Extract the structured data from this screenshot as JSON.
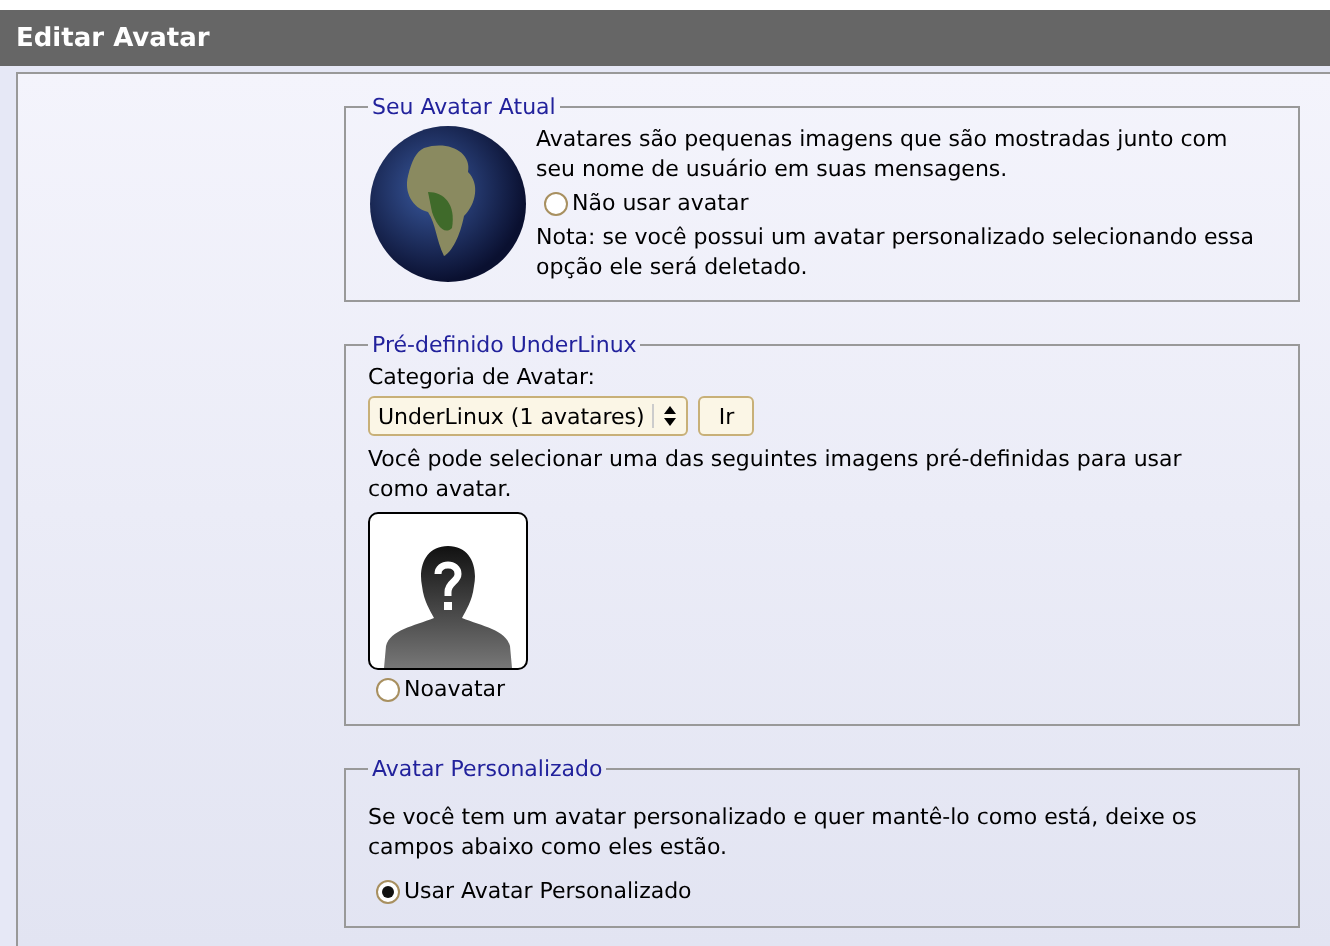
{
  "header": {
    "title": "Editar Avatar"
  },
  "current_avatar": {
    "legend": "Seu Avatar Atual",
    "description": "Avatares são pequenas imagens que são mostradas junto com seu nome de usuário em suas mensagens.",
    "option": {
      "label": "Não usar avatar",
      "selected": false
    },
    "note": "Nota: se você possui um avatar personalizado selecionando essa opção ele será deletado."
  },
  "predefined": {
    "legend": "Pré-definido UnderLinux",
    "category_label": "Categoria de Avatar:",
    "category_select": {
      "value": "UnderLinux (1 avatares)"
    },
    "go_button": "Ir",
    "description": "Você pode selecionar uma das seguintes imagens pré-definidas para usar como avatar.",
    "avatars": [
      {
        "label": "Noavatar",
        "selected": false
      }
    ]
  },
  "custom": {
    "legend": "Avatar Personalizado",
    "description": "Se você tem um avatar personalizado e quer mantê-lo como está, deixe os campos abaixo como eles estão.",
    "options": [
      {
        "label": "Usar Avatar Personalizado",
        "selected": true
      }
    ]
  }
}
